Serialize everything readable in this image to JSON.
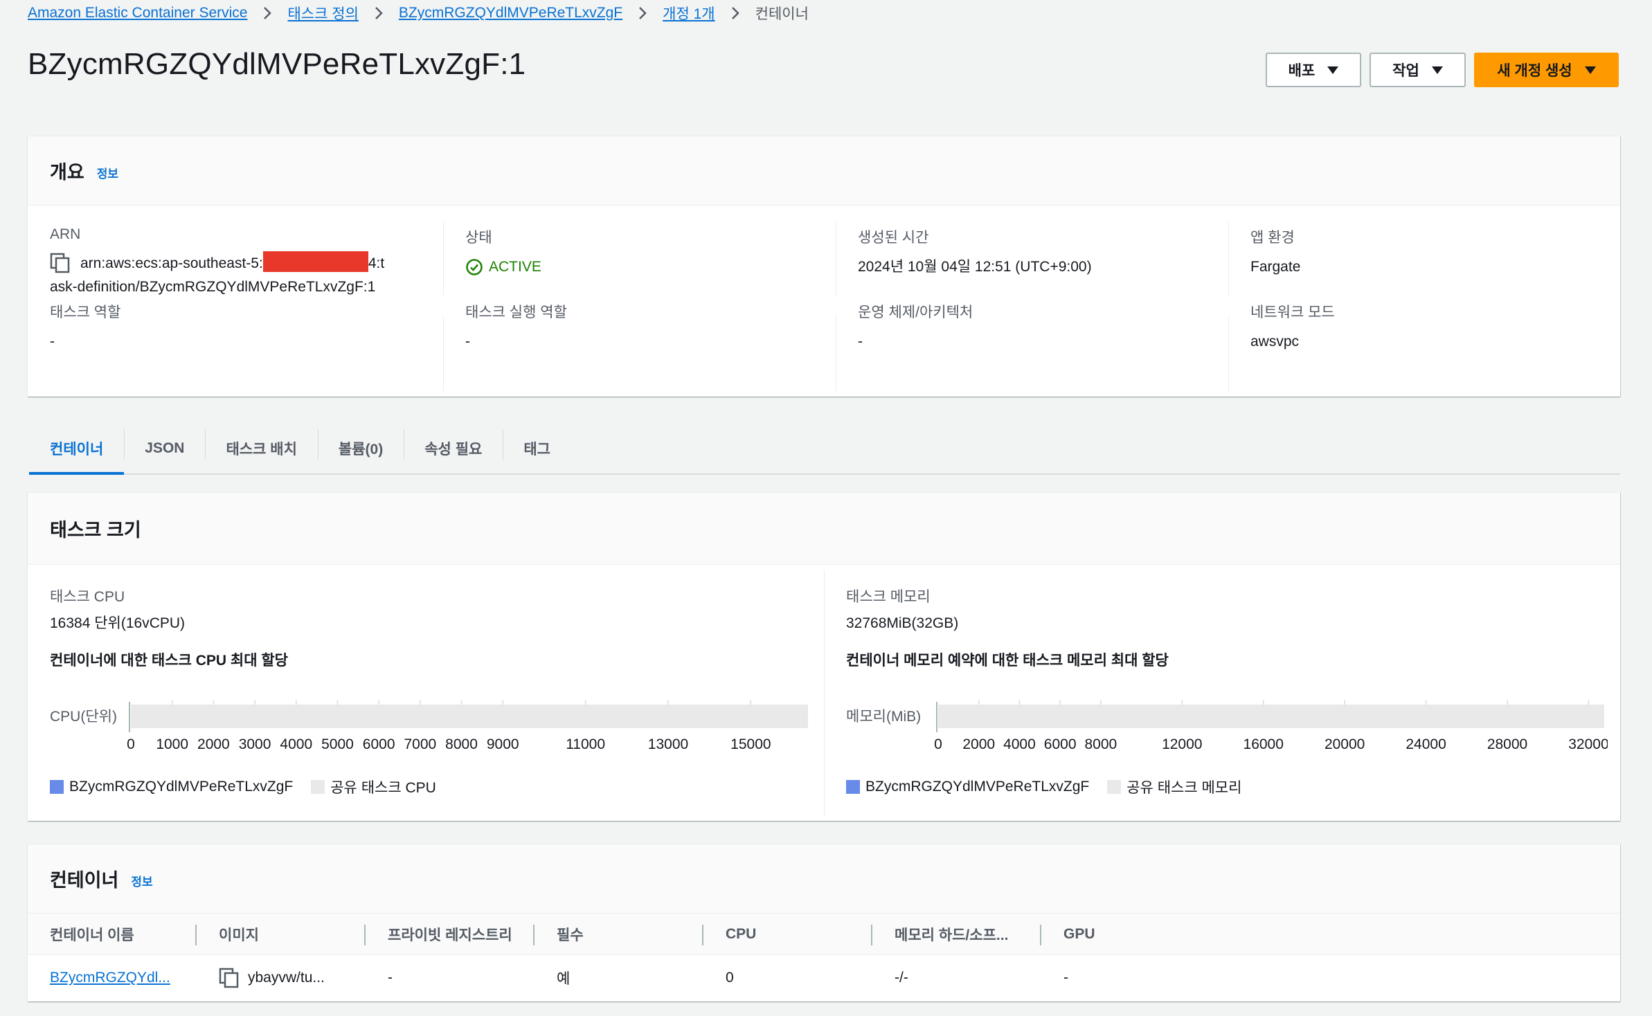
{
  "breadcrumb": {
    "items": [
      "Amazon Elastic Container Service",
      "태스크 정의",
      "BZycmRGZQYdlMVPeReTLxvZgF",
      "개정 1개"
    ],
    "current": "컨테이너"
  },
  "page_title": "BZycmRGZQYdlMVPeReTLxvZgF:1",
  "actions": {
    "deploy": "배포",
    "actions": "작업",
    "create_revision": "새 개정 생성"
  },
  "overview": {
    "title": "개요",
    "info": "정보",
    "arn_label": "ARN",
    "arn_prefix": "arn:aws:ecs:ap-southeast-5:",
    "arn_after_redact": "4:t",
    "arn_line2": "ask-definition/BZycmRGZQYdlMVPeReTLxvZgF:1",
    "status_label": "상태",
    "status_value": "ACTIVE",
    "created_label": "생성된 시간",
    "created_value": "2024년 10월 04일 12:51 (UTC+9:00)",
    "app_env_label": "앱 환경",
    "app_env_value": "Fargate",
    "task_role_label": "태스크 역할",
    "task_role_value": "-",
    "exec_role_label": "태스크 실행 역할",
    "exec_role_value": "-",
    "os_label": "운영 체제/아키텍처",
    "os_value": "-",
    "network_label": "네트워크 모드",
    "network_value": "awsvpc"
  },
  "tabs": [
    "컨테이너",
    "JSON",
    "태스크 배치",
    "볼륨(0)",
    "속성 필요",
    "태그"
  ],
  "task_size": {
    "title": "태스크 크기",
    "cpu_label": "태스크 CPU",
    "cpu_value": "16384 단위(16vCPU)",
    "cpu_sub": "컨테이너에 대한 태스크 CPU 최대 할당",
    "mem_label": "태스크 메모리",
    "mem_value": "32768MiB(32GB)",
    "mem_sub": "컨테이너 메모리 예약에 대한 태스크 메모리 최대 할당"
  },
  "chart_data": [
    {
      "type": "bar",
      "orientation": "horizontal",
      "ylabel": "CPU(단위)",
      "xlim": [
        0,
        16384
      ],
      "xticks": [
        "0",
        "1000",
        "2000",
        "3000",
        "4000",
        "5000",
        "6000",
        "7000",
        "8000",
        "9000",
        "11000",
        "13000",
        "15000"
      ],
      "xtick_values": [
        0,
        1000,
        2000,
        3000,
        4000,
        5000,
        6000,
        7000,
        8000,
        9000,
        11000,
        13000,
        15000
      ],
      "series": [
        {
          "name": "BZycmRGZQYdlMVPeReTLxvZgF",
          "values": [
            0
          ],
          "color": "#688ae8"
        },
        {
          "name": "공유 태스크 CPU",
          "values": [
            16384
          ],
          "color": "#e9e9e9"
        }
      ]
    },
    {
      "type": "bar",
      "orientation": "horizontal",
      "ylabel": "메모리(MiB)",
      "xlim": [
        0,
        32768
      ],
      "xticks": [
        "0",
        "2000",
        "4000",
        "6000",
        "8000",
        "12000",
        "16000",
        "20000",
        "24000",
        "28000",
        "32000"
      ],
      "xtick_values": [
        0,
        2000,
        4000,
        6000,
        8000,
        12000,
        16000,
        20000,
        24000,
        28000,
        32000
      ],
      "series": [
        {
          "name": "BZycmRGZQYdlMVPeReTLxvZgF",
          "values": [
            0
          ],
          "color": "#688ae8"
        },
        {
          "name": "공유 태스크 메모리",
          "values": [
            32768
          ],
          "color": "#e9e9e9"
        }
      ]
    }
  ],
  "containers": {
    "title": "컨테이너",
    "info": "정보",
    "columns": [
      "컨테이너 이름",
      "이미지",
      "프라이빗 레지스트리",
      "필수",
      "CPU",
      "메모리 하드/소프...",
      "GPU"
    ],
    "rows": [
      {
        "name": "BZycmRGZQYdl...",
        "image": "ybayvw/tu...",
        "registry": "-",
        "essential": "예",
        "cpu": "0",
        "memory": "-/-",
        "gpu": "-"
      }
    ]
  }
}
